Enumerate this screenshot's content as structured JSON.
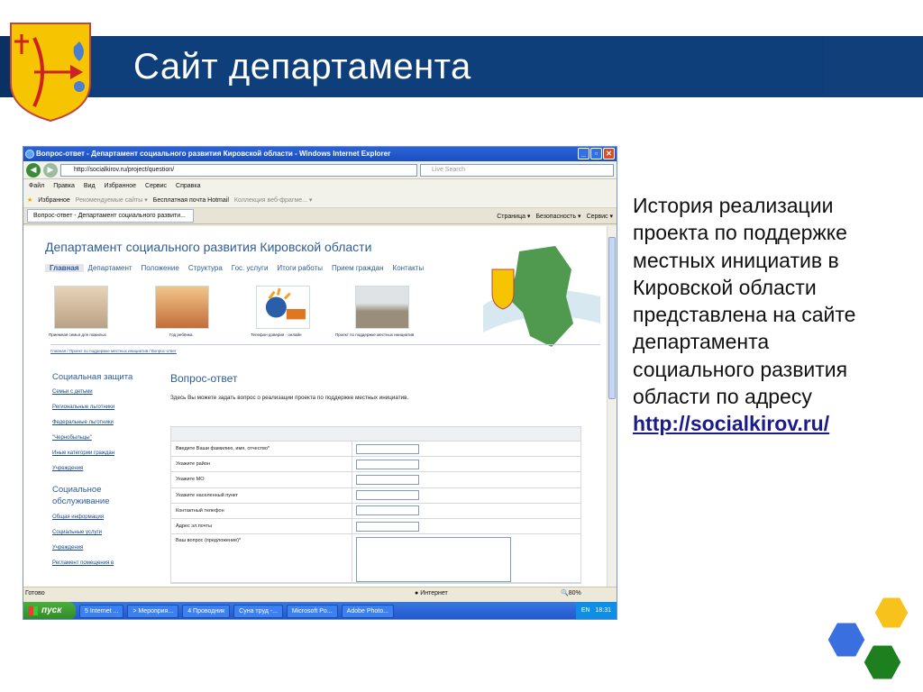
{
  "slide": {
    "title": "Сайт департамента",
    "side_text": "История реализации проекта по поддержке местных инициатив в Кировской области представлена на сайте департамента социального развития области по адресу",
    "link": "http://socialkirov.ru/"
  },
  "browser": {
    "window_title": "Вопрос-ответ - Департамент социального развития Кировской области - Windows Internet Explorer",
    "address": "http://socialkirov.ru/project/question/",
    "search_placeholder": "Live Search",
    "menu": [
      "Файл",
      "Правка",
      "Вид",
      "Избранное",
      "Сервис",
      "Справка"
    ],
    "favorites": {
      "label": "Избранное",
      "items": [
        "Рекомендуемые сайты ▾",
        "Бесплатная почта Hotmail",
        "Коллекция веб-фрагме... ▾"
      ]
    },
    "tab_label": "Вопрос-ответ - Департамент социального развити...",
    "tools": [
      "Страница ▾",
      "Безопасность ▾",
      "Сервис ▾"
    ],
    "status_text": "Готово",
    "zone": "Интернет",
    "zoom": "80%"
  },
  "site": {
    "header": "Департамент социального развития Кировской области",
    "nav": [
      "Главная",
      "Департамент",
      "Положение",
      "Структура",
      "Гос. услуги",
      "Итоги работы",
      "Прием граждан",
      "Контакты"
    ],
    "thumbs": [
      "Приемная семья для пожилых",
      "Год ребёнка",
      "Телефон доверия - онлайн",
      "Проект по поддержке местных инициатив"
    ],
    "breadcrumb": "Главная / Проект по поддержке местных инициатив / Вопрос-ответ",
    "left_nav": {
      "section1": "Социальная защита",
      "items1": [
        "Семьи с детьми",
        "Региональные льготники",
        "Федеральные льготники",
        "\"Чернобыльцы\"",
        "Иные категории граждан",
        "Учреждения"
      ],
      "section2": "Социальное обслуживание",
      "items2": [
        "Общая информация",
        "Социальные услуги",
        "Учреждения",
        "Регламент помещения в"
      ]
    },
    "page_title": "Вопрос-ответ",
    "intro": "Здесь Вы можете задать вопрос о реализации проекта по поддержке местных инициатив.",
    "form_fields": [
      "Введите Ваши фамилию, имя, отчество*",
      "Укажите район",
      "Укажите МО",
      "Укажите населенный пункт",
      "Контактный телефон",
      "Адрес эл.почты",
      "Ваш вопрос (предложение)*"
    ]
  },
  "taskbar": {
    "start": "пуск",
    "items": [
      "5 Internet ...",
      "> Мероприя...",
      "4 Проводник",
      "Суна труд -...",
      "Microsoft Po...",
      "Adobe Photo..."
    ],
    "lang": "EN",
    "clock": "18:31"
  },
  "colors": {
    "title_bar": "#0e3f7a",
    "link": "#1b1b8c",
    "hex_yellow": "#f7c21b",
    "hex_blue": "#3a6fe0",
    "hex_green": "#1e7f1e"
  }
}
